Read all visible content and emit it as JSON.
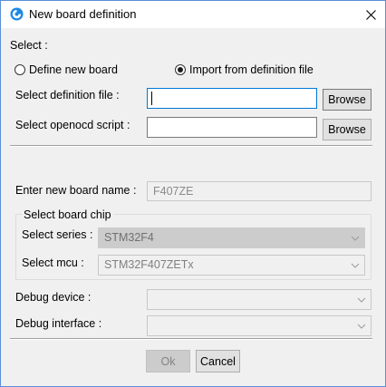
{
  "window": {
    "title": "New board definition",
    "title_icon": "app-logo-icon",
    "close_icon": "close-icon"
  },
  "select_section": {
    "label": "Select :",
    "option_define": "Define new board",
    "option_import": "Import from definition file",
    "selected": "import"
  },
  "definition_file": {
    "label": "Select definition file :",
    "value": "",
    "browse_label": "Browse"
  },
  "openocd_script": {
    "label": "Select openocd script :",
    "value": "",
    "browse_label": "Browse"
  },
  "board_name": {
    "label": "Enter new board name :",
    "value": "F407ZE"
  },
  "board_chip": {
    "group_label": "Select board chip",
    "series_label": "Select series :",
    "series_value": "STM32F4",
    "mcu_label": "Select mcu :",
    "mcu_value": "STM32F407ZETx"
  },
  "debug": {
    "device_label": "Debug device :",
    "device_value": "",
    "interface_label": "Debug interface :",
    "interface_value": ""
  },
  "footer": {
    "ok_label": "Ok",
    "cancel_label": "Cancel"
  },
  "colors": {
    "accent": "#0078d7",
    "window_border": "#5b8fd6",
    "icon_blue": "#1e88e5"
  }
}
